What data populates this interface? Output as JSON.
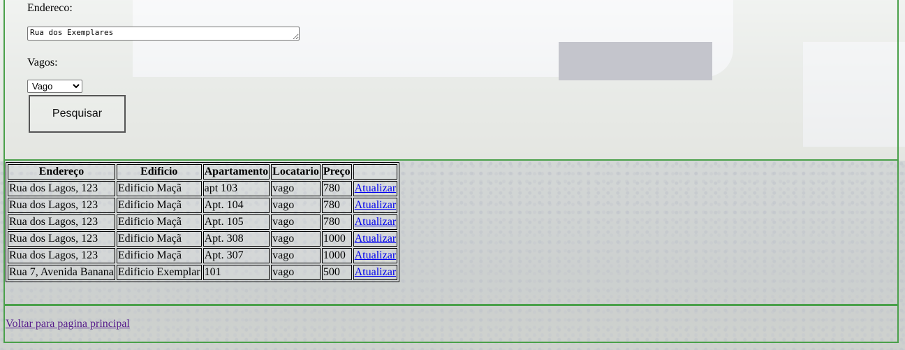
{
  "form": {
    "address_label": "Endereco:",
    "address_value": "Rua dos Exemplares",
    "vagos_label": "Vagos:",
    "vagos_selected": "Vago",
    "search_label": "Pesquisar"
  },
  "table": {
    "columns": [
      "Endereço",
      "Edificio",
      "Apartamento",
      "Locatario",
      "Preço",
      ""
    ],
    "rows": [
      [
        "Rua dos Lagos, 123",
        "Edificio Maçã",
        "apt 103",
        "vago",
        "780",
        "Atualizar"
      ],
      [
        "Rua dos Lagos, 123",
        "Edificio Maçã",
        "Apt. 104",
        "vago",
        "780",
        "Atualizar"
      ],
      [
        "Rua dos Lagos, 123",
        "Edificio Maçã",
        "Apt. 105",
        "vago",
        "780",
        "Atualizar"
      ],
      [
        "Rua dos Lagos, 123",
        "Edificio Maçã",
        "Apt. 308",
        "vago",
        "1000",
        "Atualizar"
      ],
      [
        "Rua dos Lagos, 123",
        "Edificio Maçã",
        "Apt. 307",
        "vago",
        "1000",
        "Atualizar"
      ],
      [
        "Rua 7, Avenida Banana",
        "Edificio Exemplar",
        "101",
        "vago",
        "500",
        "Atualizar"
      ]
    ]
  },
  "footer": {
    "back_link": "Voltar para pagina principal"
  },
  "colors": {
    "panel_border": "#4aa04a",
    "link": "#0000ee",
    "visited_link": "#551a8b"
  }
}
